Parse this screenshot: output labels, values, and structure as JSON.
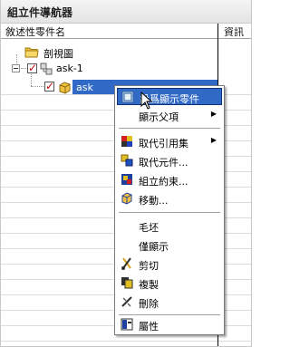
{
  "panel": {
    "title": "組立件導航器"
  },
  "columns": {
    "name": "敘述性零件名",
    "info": "資訊"
  },
  "tree": {
    "section_view": "剖視圖",
    "assembly": "ask-1",
    "component": "ask"
  },
  "context_menu": {
    "items": [
      {
        "label": "設爲顯示零件",
        "icon": "display-part-icon",
        "submenu": false,
        "highlighted": true
      },
      {
        "label": "顯示父項",
        "icon": "",
        "submenu": true,
        "highlighted": false
      },
      {
        "label": "取代引用集",
        "icon": "reference-set-icon",
        "submenu": true,
        "highlighted": false
      },
      {
        "label": "取代元件...",
        "icon": "replace-component-icon",
        "submenu": false,
        "highlighted": false
      },
      {
        "label": "組立約束...",
        "icon": "assembly-constraint-icon",
        "submenu": false,
        "highlighted": false
      },
      {
        "label": "移動...",
        "icon": "move-icon",
        "submenu": false,
        "highlighted": false
      },
      {
        "label": "毛坯",
        "icon": "",
        "submenu": false,
        "highlighted": false
      },
      {
        "label": "僅顯示",
        "icon": "",
        "submenu": false,
        "highlighted": false
      },
      {
        "label": "剪切",
        "icon": "cut-icon",
        "submenu": false,
        "highlighted": false
      },
      {
        "label": "複製",
        "icon": "copy-icon",
        "submenu": false,
        "highlighted": false
      },
      {
        "label": "刪除",
        "icon": "delete-icon",
        "submenu": false,
        "highlighted": false
      },
      {
        "label": "屬性",
        "icon": "properties-icon",
        "submenu": false,
        "highlighted": false
      }
    ]
  },
  "colors": {
    "selection": "#3169c6",
    "check": "#d00000",
    "folder": "#f0c040"
  }
}
